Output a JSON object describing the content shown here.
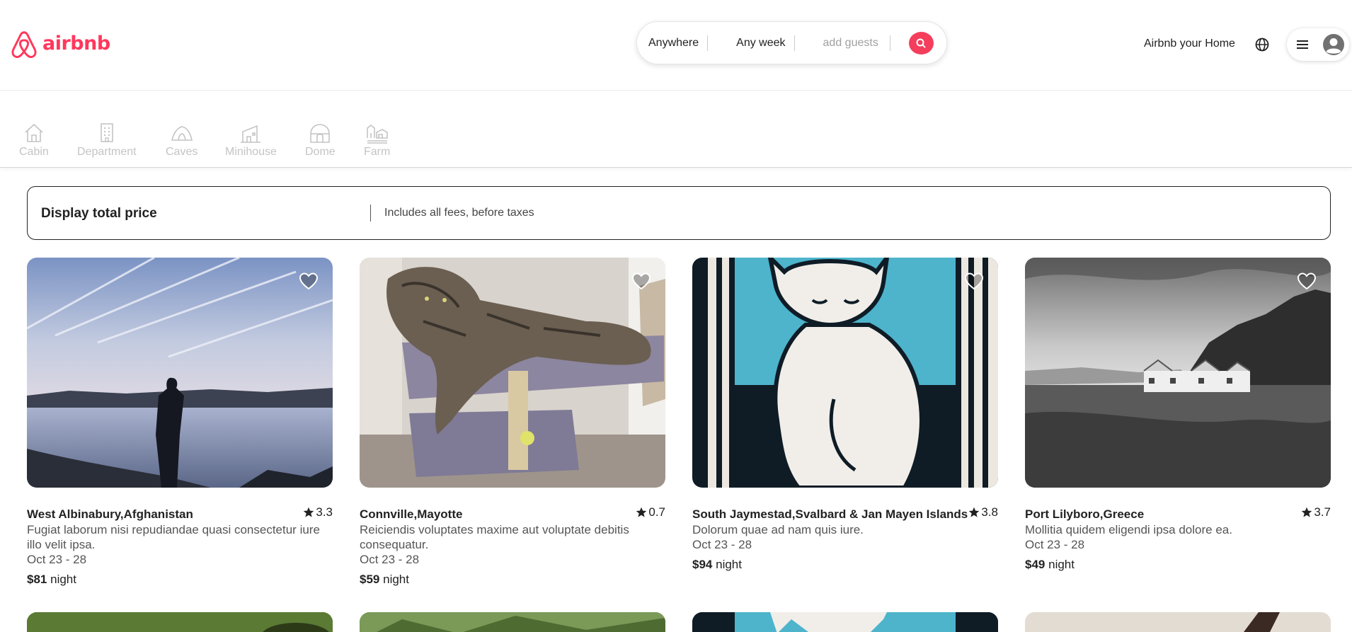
{
  "brand": {
    "name": "airbnb",
    "color": "#ff385c"
  },
  "search": {
    "location": "Anywhere",
    "week": "Any week",
    "guests_placeholder": "add guests",
    "icon": "search-icon"
  },
  "header": {
    "host_link": "Airbnb your Home",
    "globe_icon": "globe-icon",
    "menu_icon": "hamburger-menu-icon",
    "avatar_icon": "user-avatar-icon"
  },
  "categories": [
    {
      "label": "Cabin",
      "icon": "cabin-icon"
    },
    {
      "label": "Department",
      "icon": "building-icon"
    },
    {
      "label": "Caves",
      "icon": "cave-icon"
    },
    {
      "label": "Minihouse",
      "icon": "minihouse-icon"
    },
    {
      "label": "Dome",
      "icon": "dome-icon"
    },
    {
      "label": "Farm",
      "icon": "farm-icon"
    }
  ],
  "price_toggle": {
    "title": "Display total price",
    "description": "Includes all fees, before taxes"
  },
  "listings": [
    {
      "title": "West Albinabury,Afghanistan",
      "rating": "3.3",
      "description": "Fugiat laborum nisi repudiandae quasi consectetur iure illo velit ipsa.",
      "dates": "Oct 23 - 28",
      "price": "$81",
      "price_unit": "night"
    },
    {
      "title": "Connville,Mayotte",
      "rating": "0.7",
      "description": "Reiciendis voluptates maxime aut voluptate debitis consequatur.",
      "dates": "Oct 23 - 28",
      "price": "$59",
      "price_unit": "night"
    },
    {
      "title": "South Jaymestad,Svalbard & Jan Mayen Islands",
      "rating": "3.8",
      "description": "Dolorum quae ad nam quis iure.",
      "dates": "Oct 23 - 28",
      "price": "$94",
      "price_unit": "night"
    },
    {
      "title": "Port Lilyboro,Greece",
      "rating": "3.7",
      "description": "Mollitia quidem eligendi ipsa dolore ea.",
      "dates": "Oct 23 - 28",
      "price": "$49",
      "price_unit": "night"
    }
  ],
  "colors": {
    "accent": "#f43e5c",
    "text": "#222222",
    "muted_text": "#555555",
    "category_gray": "#c4c4c4"
  }
}
